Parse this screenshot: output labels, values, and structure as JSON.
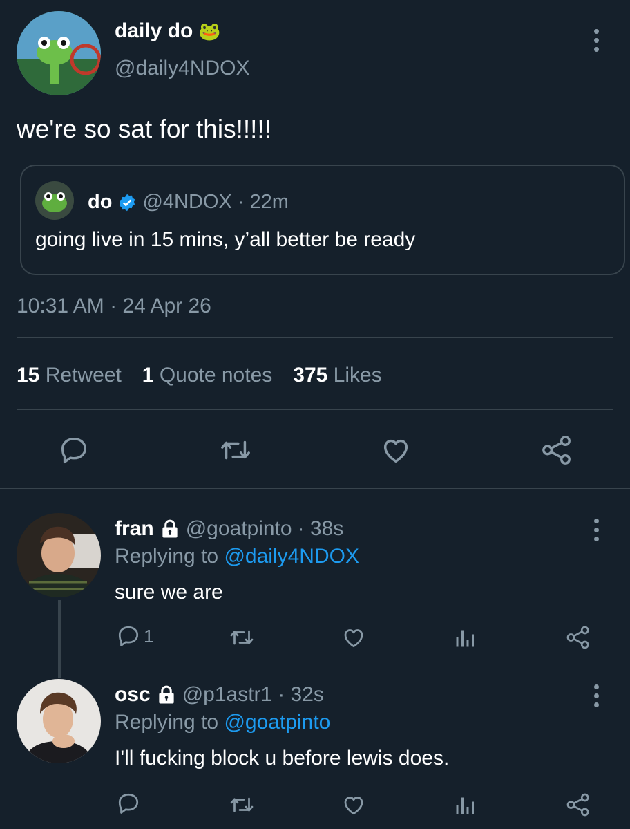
{
  "main_tweet": {
    "display_name": "daily do",
    "name_emoji": "🐸",
    "handle": "@daily4NDOX",
    "text": "we're so sat for this!!!!!",
    "timestamp": "10:31 AM · 24 Apr 26"
  },
  "quoted_tweet": {
    "display_name": "do",
    "handle": "@4NDOX",
    "separator": "·",
    "time": "22m",
    "text": "going live in 15 mins, y’all better be ready"
  },
  "stats": [
    {
      "count": "15",
      "label": "Retweet"
    },
    {
      "count": "1",
      "label": "Quote notes"
    },
    {
      "count": "375",
      "label": "Likes"
    }
  ],
  "replies": [
    {
      "display_name": "fran",
      "handle": "@goatpinto",
      "time": "· 38s",
      "replying_prefix": "Replying to",
      "replying_to": "@daily4NDOX",
      "text": "sure we are",
      "reply_count": "1"
    },
    {
      "display_name": "osc",
      "handle": "@p1astr1",
      "time": "· 32s",
      "replying_prefix": "Replying to",
      "replying_to": "@goatpinto",
      "text": "I'll fucking block u before lewis does.",
      "reply_count": ""
    }
  ],
  "colors": {
    "background": "#15202b",
    "muted": "#8899a6",
    "accent": "#1d9bf0",
    "divider": "#38444d",
    "verified": "#1d9bf0"
  },
  "icons": [
    "more-icon",
    "verified-icon",
    "lock-icon",
    "reply-icon",
    "retweet-icon",
    "like-icon",
    "share-icon",
    "analytics-icon"
  ]
}
